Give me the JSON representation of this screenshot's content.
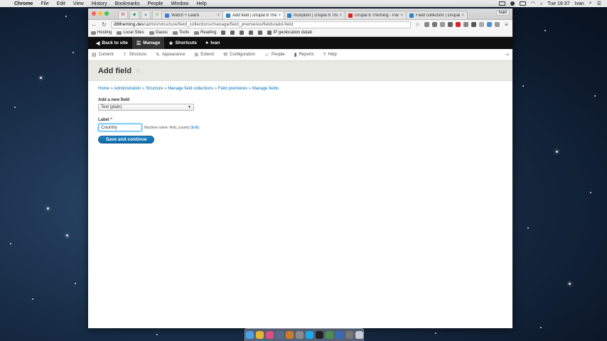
{
  "menubar": {
    "app": "Chrome",
    "items": [
      "File",
      "Edit",
      "View",
      "History",
      "Bookmarks",
      "People",
      "Window",
      "Help"
    ],
    "clock": "Tue 18:37",
    "user": "Ivan"
  },
  "browser": {
    "profile": "Ivan",
    "tabs": [
      {
        "label": "Watch + Learn",
        "color": "#3b7dd8"
      },
      {
        "label": "Add field | Drupal 8 Theme",
        "color": "#2a82c9",
        "active": true
      },
      {
        "label": "Inception | Drupal 8 Them",
        "color": "#2a82c9"
      },
      {
        "label": "Drupal 8 Theming - Part 1",
        "color": "#d22"
      },
      {
        "label": "Field collection | Drupal.o",
        "color": "#2a82c9"
      }
    ],
    "url_host": "d8theming.dev",
    "url_path": "/admin/structure/field_collections/manage/field_premieres/fields/add-field",
    "bookmarks": [
      "Hosting",
      "Local Sites",
      "Gauss",
      "Tools",
      "Reading",
      "IP geolocation datab"
    ]
  },
  "drupal_toolbar": {
    "back": "Back to site",
    "manage": "Manage",
    "shortcuts": "Shortcuts",
    "user": "Ivan"
  },
  "tray": {
    "items": [
      "Content",
      "Structure",
      "Appearance",
      "Extend",
      "Configuration",
      "People",
      "Reports",
      "Help"
    ]
  },
  "page": {
    "title": "Add field",
    "breadcrumb": [
      "Home",
      "Administration",
      "Structure",
      "Manage field collections",
      "Field premieres",
      "Manage fields"
    ],
    "add_new_field_label": "Add a new field",
    "field_type_selected": "Text (plain)",
    "label_label": "Label",
    "label_value": "Country",
    "machine_name_prefix": "Machine name: field_country",
    "machine_name_edit": "[Edit]",
    "submit_label": "Save and continue"
  }
}
